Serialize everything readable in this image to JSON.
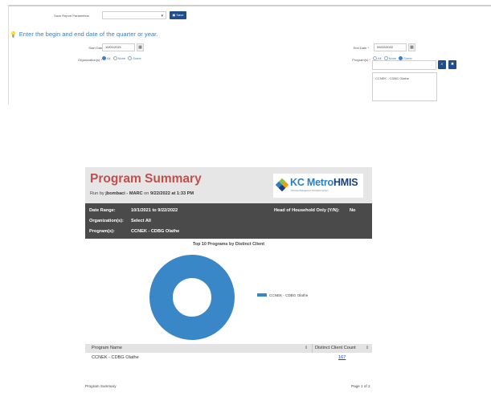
{
  "form": {
    "saved_params_label": "Save Report Parameters",
    "saved_params_value": "",
    "save_button": "Save",
    "hint": "Enter the begin and end date of the quarter or year.",
    "start_date_label": "Start Date",
    "start_date_value": "10/01/2021",
    "end_date_label": "End Date",
    "end_date_value": "09/22/2022",
    "org_label": "Organization(s)",
    "org_options": [
      "All",
      "None",
      "Some"
    ],
    "org_selected": "All",
    "program_label": "Program(s)",
    "program_options": [
      "All",
      "None",
      "Some"
    ],
    "program_selected": "Some",
    "program_search_value": "",
    "program_list": [
      "CCNEK - CDBG Olathe"
    ]
  },
  "report": {
    "title": "Program Summary",
    "run_by_prefix": "Run by",
    "run_by_user": "jbombaci - MARC",
    "run_by_on": "on",
    "run_by_datetime": "9/22/2022 at 1:33 PM",
    "logo": {
      "kc": "KC Metro",
      "hmis": "HMIS",
      "sub": "Homeless Management Information System"
    },
    "meta": {
      "date_range_label": "Date Range:",
      "date_range_value": "10/1/2021 to 9/22/2022",
      "org_label": "Organization(s):",
      "org_value": "Select All",
      "program_label": "Program(s):",
      "program_value": "CCNEK - CDBG Olathe",
      "hoh_label": "Head of Household Only (Y/N):",
      "hoh_value": "No"
    },
    "table": {
      "col1": "Program Name",
      "col2": "Distinct Client Count",
      "rows": [
        {
          "name": "CCNEK - CDBG Olathe",
          "count": "167"
        }
      ]
    },
    "footer_left": "Program Summary",
    "footer_right": "Page 1 of 2"
  },
  "chart_data": {
    "type": "pie",
    "title": "Top 10 Programs by Distinct Client",
    "donut": true,
    "categories": [
      "CCNEK - CDBG Olathe"
    ],
    "values": [
      167
    ],
    "colors": [
      "#3a87c8"
    ],
    "legend": "right"
  }
}
